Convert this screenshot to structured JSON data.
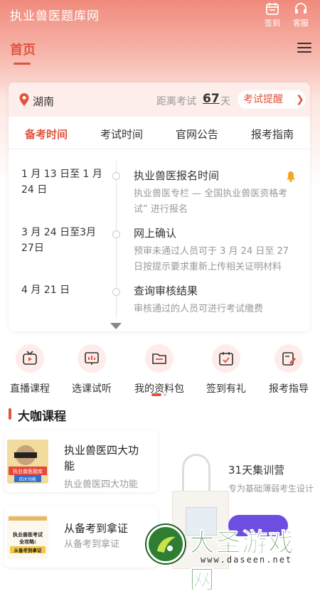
{
  "app": {
    "title": "执业兽医题库网"
  },
  "top_actions": [
    {
      "label": "签到",
      "icon": "calendar-icon"
    },
    {
      "label": "客服",
      "icon": "headset-icon"
    }
  ],
  "nav": {
    "home": "首页",
    "menu_icon": "hamburger-icon"
  },
  "exam_card": {
    "region": "湖南",
    "countdown_prefix": "距离考试",
    "countdown_days": "67",
    "countdown_unit": "天",
    "remind_label": "考试提醒",
    "tabs": [
      {
        "label": "备考时间",
        "active": true
      },
      {
        "label": "考试时间",
        "active": false
      },
      {
        "label": "官网公告",
        "active": false
      },
      {
        "label": "报考指南",
        "active": false
      }
    ],
    "timeline": [
      {
        "date_line1": "1 月 13 日至 1 月",
        "date_line2": "24 日",
        "title": "执业兽医报名时间",
        "desc_line1": "执业兽医专栏 — 全国执业兽医资格考",
        "desc_line2": "试” 进行报名",
        "bell": true
      },
      {
        "date_line1": "3 月 24 日至3月",
        "date_line2": "27日",
        "title": "网上确认",
        "desc_line1": "预审未通过人员可于 3 月 24 日至 27",
        "desc_line2": "日按提示要求重新上传相关证明材料"
      },
      {
        "date_line1": "4 月 21 日",
        "title": "查询审核结果",
        "desc_line1": "审核通过的人员可进行考试缴费"
      }
    ]
  },
  "quick_links": [
    {
      "label": "直播课程",
      "icon": "tv-icon"
    },
    {
      "label": "选课试听",
      "icon": "chart-board-icon"
    },
    {
      "label": "我的资料包",
      "icon": "folder-icon"
    },
    {
      "label": "签到有礼",
      "icon": "calendar-check-icon"
    },
    {
      "label": "报考指导",
      "icon": "edit-doc-icon"
    }
  ],
  "section": {
    "title": "大咖课程"
  },
  "courses": [
    {
      "title_line1": "执业兽医四大功",
      "title_line2": "能",
      "subtitle": "执业兽医四大功能",
      "thumb_text_1": "执业兽医题库",
      "thumb_text_2": "四大功能"
    },
    {
      "title_line1": "从备考到拿证",
      "subtitle": "从备考到拿证",
      "thumb_text_1": "执业兽医考试",
      "thumb_text_2": "全攻略:",
      "thumb_text_3": "从备考到拿证"
    }
  ],
  "promo": {
    "title": "31天集训营",
    "subtitle": "专为基础薄弱考生设计"
  },
  "watermark": {
    "brand": "大圣游戏网",
    "url": "www.daseen.net"
  },
  "colors": {
    "accent": "#e0533f",
    "header_gradient_top": "#f08a7c",
    "promo_button": "#6c4ee0",
    "watermark_green": "#2e7d32"
  }
}
